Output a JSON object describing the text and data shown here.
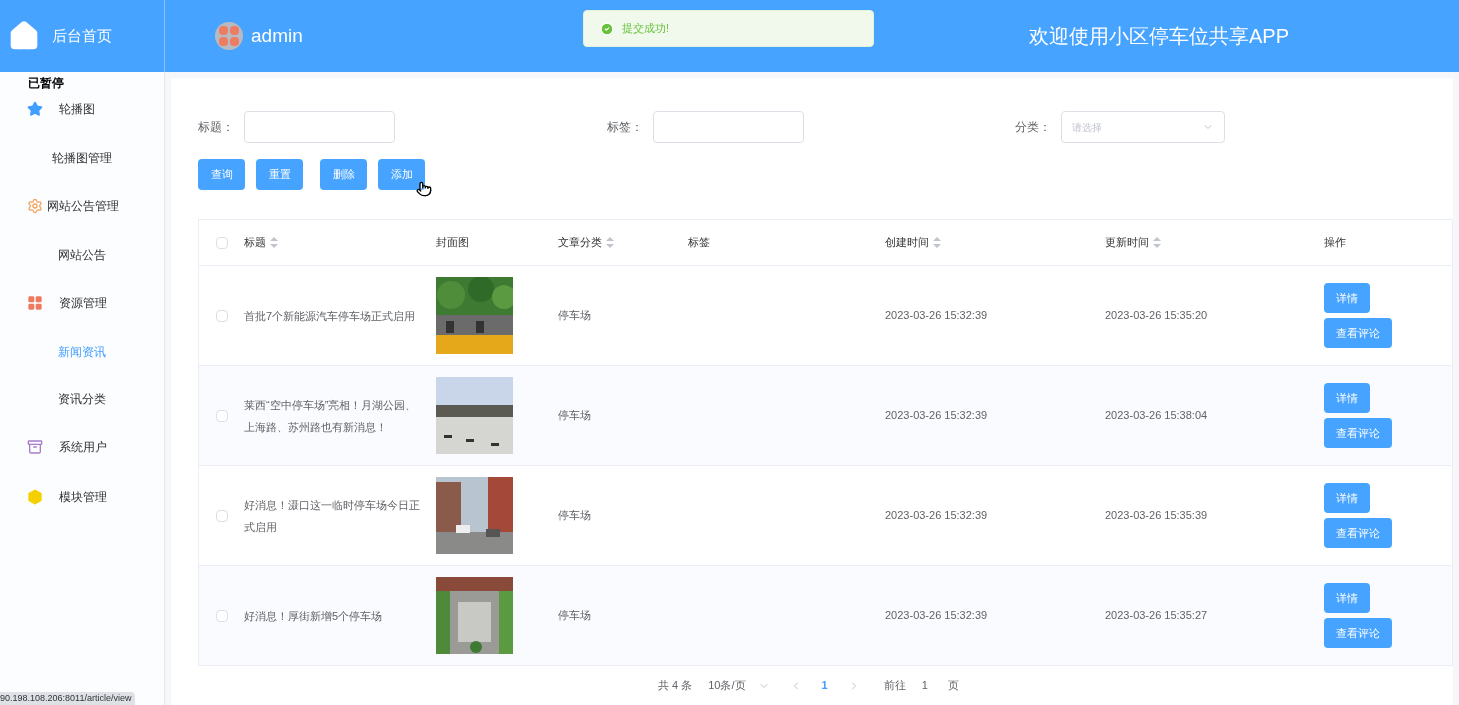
{
  "brand": {
    "title": "后台首页"
  },
  "user": {
    "name": "admin"
  },
  "toast": {
    "message": "提交成功!"
  },
  "header_title": "欢迎使用小区停车位共享APP",
  "overlay_label": "已暂停",
  "status_url": "90.198.108.206:8011/article/view",
  "sidebar": {
    "items": [
      {
        "label": "轮播图",
        "children": [
          {
            "label": "轮播图管理",
            "selected": false
          }
        ]
      },
      {
        "label": "网站公告管理",
        "children": [
          {
            "label": "网站公告",
            "selected": false
          }
        ]
      },
      {
        "label": "资源管理",
        "children": [
          {
            "label": "新闻资讯",
            "selected": true
          },
          {
            "label": "资讯分类",
            "selected": false
          }
        ]
      },
      {
        "label": "系统用户"
      },
      {
        "label": "模块管理"
      }
    ]
  },
  "filters": [
    {
      "label": "标题：",
      "kind": "input"
    },
    {
      "label": "标签：",
      "kind": "input"
    },
    {
      "label": "分类：",
      "kind": "select",
      "placeholder": "请选择"
    }
  ],
  "actions": [
    "查询",
    "重置",
    "删除",
    "添加"
  ],
  "table": {
    "all_checked": false,
    "columns": [
      {
        "label": "标题",
        "sortable": true
      },
      {
        "label": "封面图",
        "sortable": false
      },
      {
        "label": "文章分类",
        "sortable": true
      },
      {
        "label": "标签",
        "sortable": false
      },
      {
        "label": "创建时间",
        "sortable": true
      },
      {
        "label": "更新时间",
        "sortable": true
      },
      {
        "label": "操作",
        "sortable": false
      }
    ],
    "rows": [
      {
        "title": "首批7个新能源汽车停车场正式启用",
        "category": "停车场",
        "created": "2023-03-26 15:32:39",
        "updated": "2023-03-26 15:35:20",
        "checked": false,
        "buttons": [
          "详情",
          "查看评论"
        ]
      },
      {
        "title": "莱西“空中停车场”亮相！月湖公园、上海路、苏州路也有新消息！",
        "category": "停车场",
        "created": "2023-03-26 15:32:39",
        "updated": "2023-03-26 15:38:04",
        "checked": false,
        "buttons": [
          "详情",
          "查看评论"
        ]
      },
      {
        "title": "好消息！滠口这一临时停车场今日正式启用",
        "category": "停车场",
        "created": "2023-03-26 15:32:39",
        "updated": "2023-03-26 15:35:39",
        "checked": false,
        "buttons": [
          "详情",
          "查看评论"
        ]
      },
      {
        "title": "好消息！厚街新增5个停车场",
        "category": "停车场",
        "created": "2023-03-26 15:32:39",
        "updated": "2023-03-26 15:35:27",
        "checked": false,
        "buttons": [
          "详情",
          "查看评论"
        ]
      }
    ]
  },
  "pagination": {
    "total": "共 4 条",
    "page_size": "10条/页",
    "pages": [
      {
        "label": "1",
        "selected": true
      }
    ],
    "goto_label": "前往",
    "goto_value": "1",
    "goto_suffix": "页"
  }
}
